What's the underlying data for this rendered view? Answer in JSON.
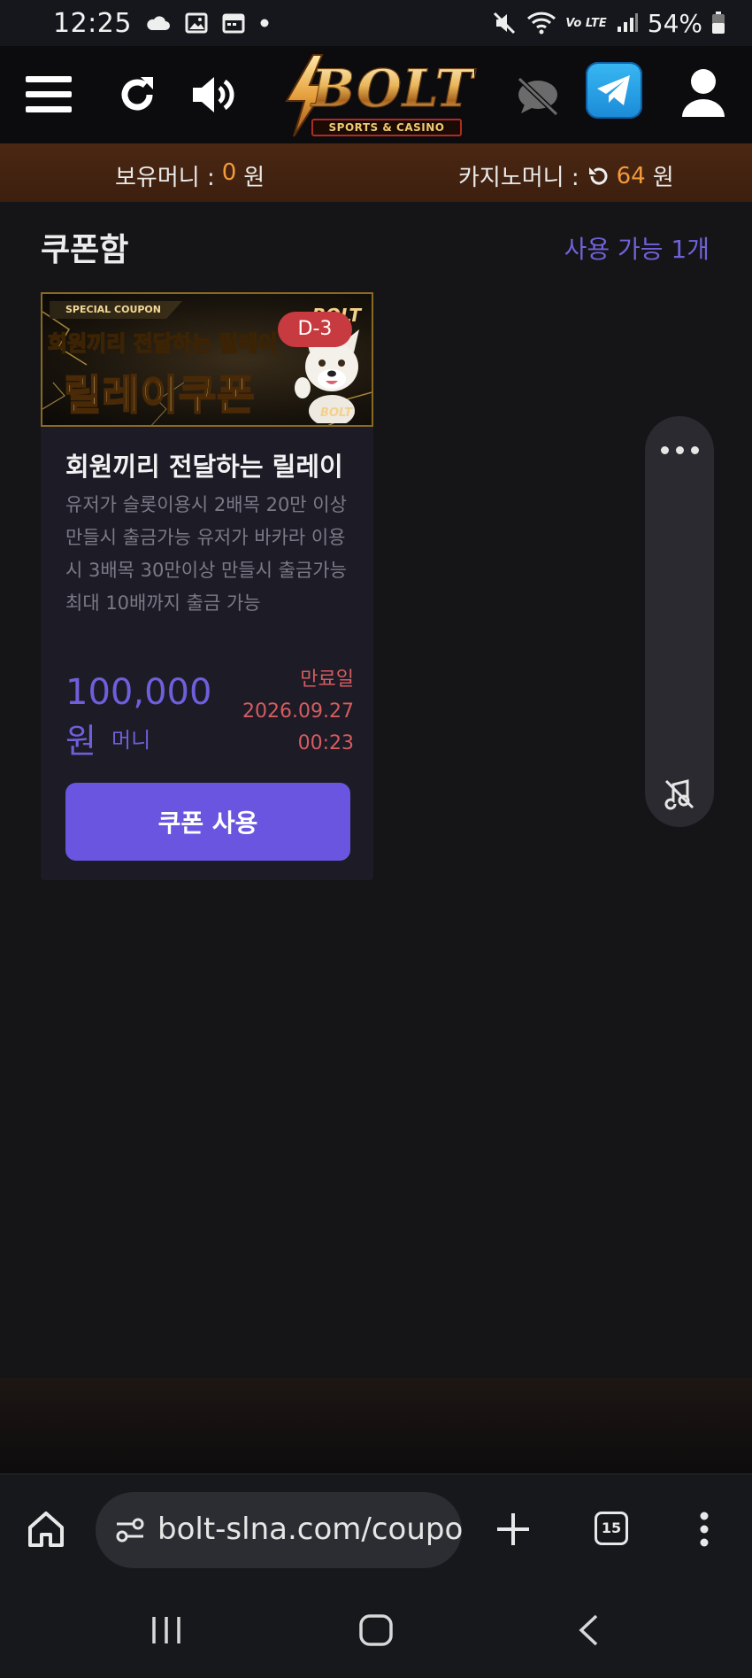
{
  "status_bar": {
    "time": "12:25",
    "battery": "54%",
    "left_icons": [
      "cloud-icon",
      "image-icon",
      "calendar-icon",
      "dot-icon"
    ],
    "right_icons": [
      "mute-icon",
      "wifi-icon",
      "volte-icon",
      "signal-icon",
      "battery-icon"
    ],
    "volte_label": "Vo LTE"
  },
  "header": {
    "logo_text": "BOLT",
    "logo_sub": "SPORTS & CASINO",
    "icons": [
      "menu-icon",
      "refresh-icon",
      "volume-icon",
      "chat-off-icon",
      "telegram-icon",
      "user-icon"
    ]
  },
  "money_bar": {
    "held_label": "보유머니 :",
    "held_value": "0",
    "held_unit": "원",
    "casino_label": "카지노머니 :",
    "casino_value": "64",
    "casino_unit": "원"
  },
  "section": {
    "title": "쿠폰함",
    "available": "사용 가능 1개"
  },
  "coupon": {
    "banner_special": "SPECIAL COUPON",
    "banner_line1": "회원끼리 전달하는 릴레이",
    "banner_line2": "릴레이쿠폰",
    "banner_brand": "BOLT",
    "d_badge": "D-3",
    "title": "회원끼리 전달하는 릴레이",
    "description": "유저가 슬롯이용시 2배목 20만 이상 만들시 출금가능 유저가 바카라 이용시 3배목 30만이상 만들시 출금가능 최대 10배까지 출금 가능",
    "amount": "100,000",
    "amount_unit": "원",
    "amount_type": "머니",
    "expiry_label": "만료일",
    "expiry_date": "2026.09.27",
    "expiry_time": "00:23",
    "use_button": "쿠폰 사용"
  },
  "browser": {
    "url": "bolt-slna.com/coupo",
    "tab_count": "15",
    "icons": [
      "home-icon",
      "site-settings-icon",
      "new-tab-icon",
      "tabs-icon",
      "more-icon"
    ]
  },
  "colors": {
    "accent_purple": "#6a55e0",
    "money_orange": "#f39a3a",
    "expiry_red": "#d65c60",
    "money_bar_brown": "#4a2713",
    "background": "#151417"
  }
}
